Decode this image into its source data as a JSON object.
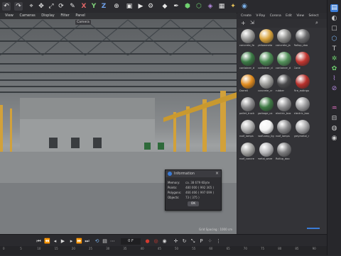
{
  "viewport": {
    "menu": [
      "View",
      "Cameras",
      "Display",
      "Filter",
      "Panel"
    ],
    "camera_label": "Camera",
    "scale_readout": "Grid Spacing : 1000 cm"
  },
  "info_dialog": {
    "title": "Information",
    "rows": [
      {
        "label": "Memory:",
        "value": "ca. 38 679 KByte"
      },
      {
        "label": "Points:",
        "value": "480 000 ( 992 365 )"
      },
      {
        "label": "Polygons:",
        "value": "466 466 ( 997 699 )"
      },
      {
        "label": "Objects:",
        "value": "73 ( 375 )"
      }
    ],
    "ok_label": "OK"
  },
  "material_panel": {
    "menu": [
      "Create",
      "V-Ray",
      "Corona",
      "Edit",
      "View",
      "Select"
    ],
    "materials": [
      {
        "name": "concrete_fo",
        "color": "#9a9a98"
      },
      {
        "name": "yellowmeta",
        "color": "#d7a23a"
      },
      {
        "name": "concrete_ja",
        "color": "#8c8c8a"
      },
      {
        "name": "Rollup_doo",
        "color": "#6a6a6c"
      },
      {
        "name": "container_d",
        "color": "#3b7a45"
      },
      {
        "name": "container_d",
        "color": "#4a8a52"
      },
      {
        "name": "container_d",
        "color": "#53915a"
      },
      {
        "name": "Cone",
        "color": "#c2352f"
      },
      {
        "name": "Darrell",
        "color": "#e08b1e"
      },
      {
        "name": "concrete_cr",
        "color": "#9c9c9a"
      },
      {
        "name": "rubber",
        "color": "#4a4a4c"
      },
      {
        "name": "Fire_extingu",
        "color": "#b8302b"
      },
      {
        "name": "pallet_truck",
        "color": "#8a8a8c"
      },
      {
        "name": "garbage_ca",
        "color": "#3e7a44"
      },
      {
        "name": "electric_box",
        "color": "#8e8e90"
      },
      {
        "name": "electric_box",
        "color": "#9a9a9c"
      },
      {
        "name": "roof_lamps",
        "color": "#b0b0b0"
      },
      {
        "name": "roofLamp_lig",
        "color": "#f4f4f4"
      },
      {
        "name": "roof_lamps",
        "color": "#8a8a8c"
      },
      {
        "name": "greymetal_r",
        "color": "#a6a6a8"
      },
      {
        "name": "roof_concre",
        "color": "#a2a2a0"
      },
      {
        "name": "metal_ware",
        "color": "#b6b6b8"
      },
      {
        "name": "Rollup_doo",
        "color": "#7c7c7e"
      }
    ]
  },
  "timeline": {
    "frame": "0 F",
    "ticks": [
      "0",
      "5",
      "10",
      "15",
      "20",
      "25",
      "30",
      "35",
      "40",
      "45",
      "50",
      "55",
      "60",
      "65",
      "70",
      "75",
      "80",
      "85",
      "90"
    ]
  },
  "colors": {
    "accent": "#3a7bd5",
    "record_red": "#d33a2f"
  }
}
